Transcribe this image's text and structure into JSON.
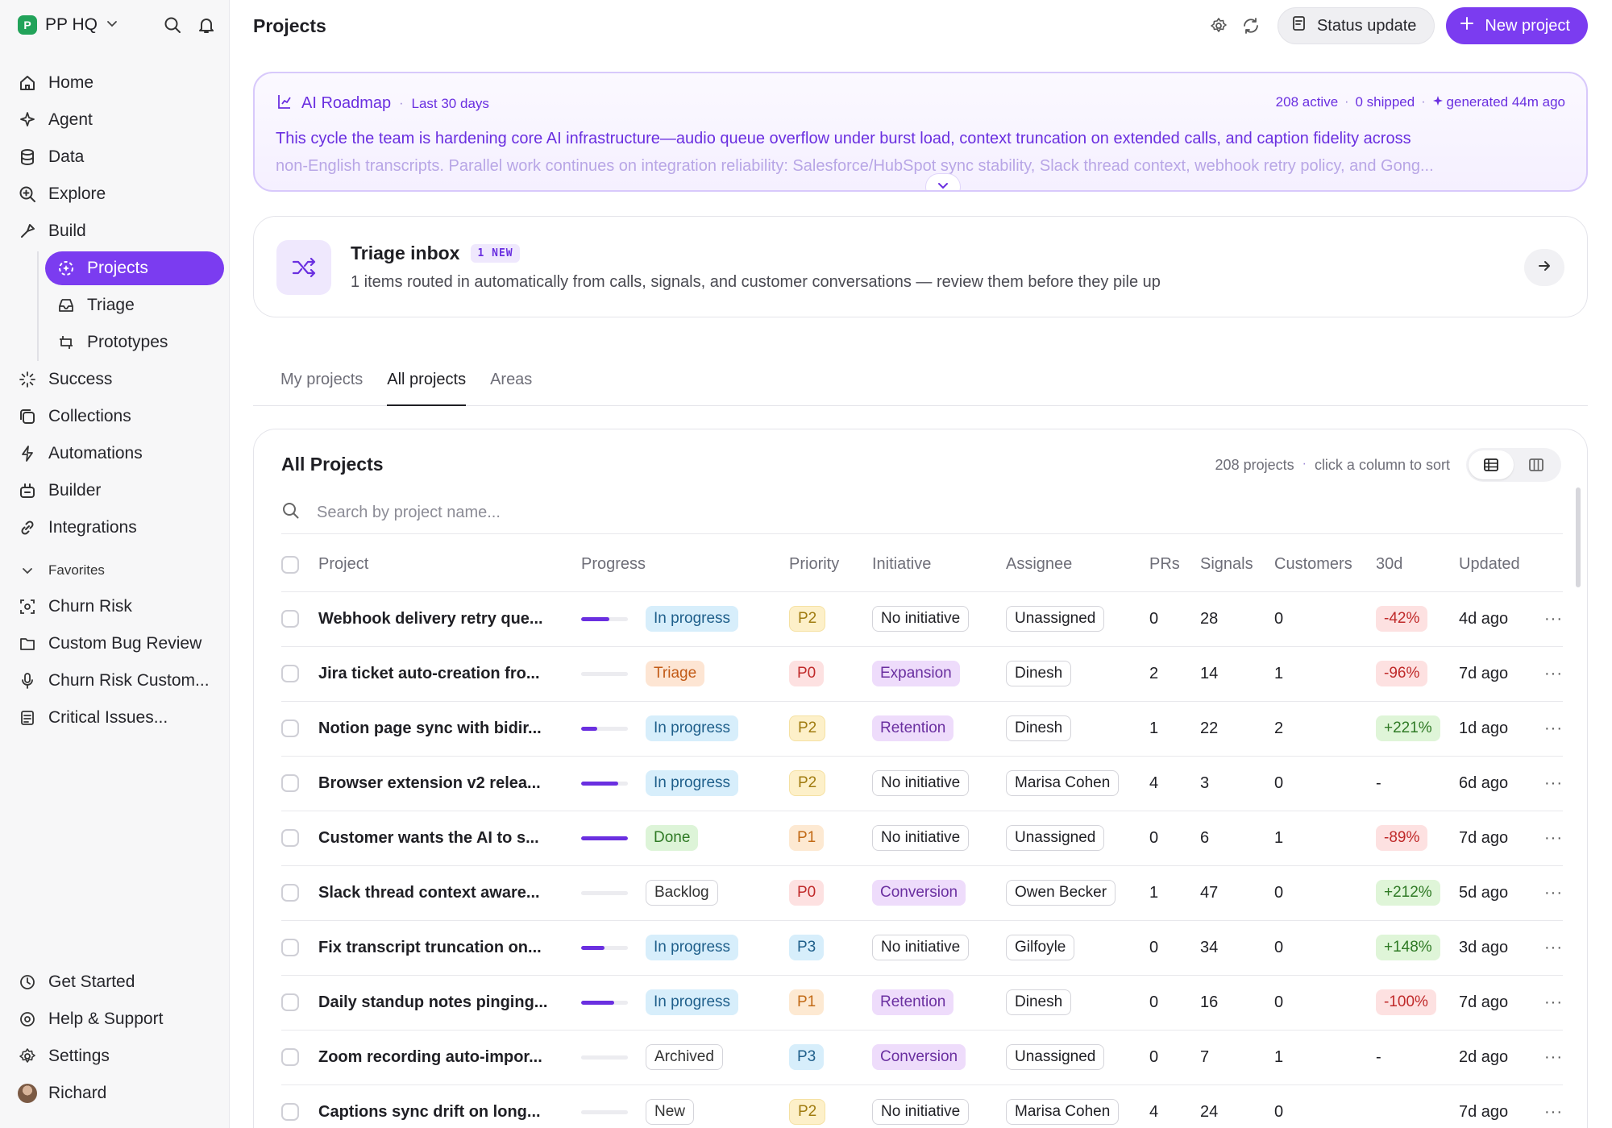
{
  "workspace": {
    "name": "PP HQ",
    "logo_letter": "P"
  },
  "sidebar": {
    "nav": [
      {
        "label": "Home",
        "icon": "home-icon"
      },
      {
        "label": "Agent",
        "icon": "agent-icon"
      },
      {
        "label": "Data",
        "icon": "database-icon"
      },
      {
        "label": "Explore",
        "icon": "explore-icon"
      },
      {
        "label": "Build",
        "icon": "build-icon"
      }
    ],
    "build_sub": [
      {
        "label": "Projects",
        "icon": "projects-icon",
        "active": true
      },
      {
        "label": "Triage",
        "icon": "triage-icon"
      },
      {
        "label": "Prototypes",
        "icon": "prototypes-icon"
      }
    ],
    "nav2": [
      {
        "label": "Success",
        "icon": "success-icon"
      },
      {
        "label": "Collections",
        "icon": "collections-icon"
      },
      {
        "label": "Automations",
        "icon": "automations-icon"
      },
      {
        "label": "Builder",
        "icon": "builder-icon"
      },
      {
        "label": "Integrations",
        "icon": "integrations-icon"
      }
    ],
    "favorites_label": "Favorites",
    "favorites": [
      {
        "label": "Churn Risk",
        "icon": "churn-icon"
      },
      {
        "label": "Custom Bug Review",
        "icon": "folder-icon"
      },
      {
        "label": "Churn Risk Custom...",
        "icon": "microphone-icon"
      },
      {
        "label": "Critical Issues...",
        "icon": "document-icon"
      }
    ],
    "bottom": [
      {
        "label": "Get Started",
        "icon": "clock-icon"
      },
      {
        "label": "Help & Support",
        "icon": "help-icon"
      },
      {
        "label": "Settings",
        "icon": "settings-icon"
      },
      {
        "label": "Richard",
        "icon": "avatar"
      }
    ]
  },
  "header": {
    "title": "Projects",
    "status_update": "Status update",
    "new_project": "New project"
  },
  "roadmap": {
    "title": "AI Roadmap",
    "period": "Last 30 days",
    "active": "208 active",
    "shipped": "0 shipped",
    "generated": "generated 44m ago",
    "line1": "This cycle the team is hardening core AI infrastructure—audio queue overflow under burst load, context truncation on extended calls, and caption fidelity across",
    "line2": "non-English transcripts. Parallel work continues on integration reliability: Salesforce/HubSpot sync stability, Slack thread context, webhook retry policy, and Gong..."
  },
  "triage": {
    "title": "Triage inbox",
    "badge": "1 NEW",
    "subtitle": "1 items routed in automatically from calls, signals, and customer conversations — review them before they pile up"
  },
  "tabs": [
    {
      "label": "My projects",
      "active": false
    },
    {
      "label": "All projects",
      "active": true
    },
    {
      "label": "Areas",
      "active": false
    }
  ],
  "panel": {
    "title": "All Projects",
    "count": "208 projects",
    "hint": "click a column to sort",
    "search_placeholder": "Search by project name..."
  },
  "columns": [
    "Project",
    "Progress",
    "Priority",
    "Initiative",
    "Assignee",
    "PRs",
    "Signals",
    "Customers",
    "30d",
    "Updated"
  ],
  "rows": [
    {
      "name": "Webhook delivery retry que...",
      "progress": 0.6,
      "status": "In progress",
      "status_kind": "progress",
      "priority": "P2",
      "initiative": "No initiative",
      "assignee": "Unassigned",
      "prs": "0",
      "signals": "28",
      "customers": "0",
      "delta": "-42%",
      "delta_kind": "neg",
      "updated": "4d ago"
    },
    {
      "name": "Jira ticket auto-creation fro...",
      "progress": 0,
      "status": "Triage",
      "status_kind": "triage",
      "priority": "P0",
      "initiative": "Expansion",
      "assignee": "Dinesh",
      "prs": "2",
      "signals": "14",
      "customers": "1",
      "delta": "-96%",
      "delta_kind": "neg",
      "updated": "7d ago"
    },
    {
      "name": "Notion page sync with bidir...",
      "progress": 0.35,
      "status": "In progress",
      "status_kind": "progress",
      "priority": "P2",
      "initiative": "Retention",
      "assignee": "Dinesh",
      "prs": "1",
      "signals": "22",
      "customers": "2",
      "delta": "+221%",
      "delta_kind": "pos",
      "updated": "1d ago"
    },
    {
      "name": "Browser extension v2 relea...",
      "progress": 0.8,
      "status": "In progress",
      "status_kind": "progress",
      "priority": "P2",
      "initiative": "No initiative",
      "assignee": "Marisa Cohen",
      "prs": "4",
      "signals": "3",
      "customers": "0",
      "delta": "-",
      "delta_kind": "none",
      "updated": "6d ago"
    },
    {
      "name": "Customer wants the AI to s...",
      "progress": 1,
      "status": "Done",
      "status_kind": "done",
      "priority": "P1",
      "initiative": "No initiative",
      "assignee": "Unassigned",
      "prs": "0",
      "signals": "6",
      "customers": "1",
      "delta": "-89%",
      "delta_kind": "neg",
      "updated": "7d ago"
    },
    {
      "name": "Slack thread context aware...",
      "progress": 0,
      "status": "Backlog",
      "status_kind": "backlog",
      "priority": "P0",
      "initiative": "Conversion",
      "assignee": "Owen Becker",
      "prs": "1",
      "signals": "47",
      "customers": "0",
      "delta": "+212%",
      "delta_kind": "pos",
      "updated": "5d ago"
    },
    {
      "name": "Fix transcript truncation on...",
      "progress": 0.5,
      "status": "In progress",
      "status_kind": "progress",
      "priority": "P3",
      "initiative": "No initiative",
      "assignee": "Gilfoyle",
      "prs": "0",
      "signals": "34",
      "customers": "0",
      "delta": "+148%",
      "delta_kind": "pos",
      "updated": "3d ago"
    },
    {
      "name": "Daily standup notes pinging...",
      "progress": 0.7,
      "status": "In progress",
      "status_kind": "progress",
      "priority": "P1",
      "initiative": "Retention",
      "assignee": "Dinesh",
      "prs": "0",
      "signals": "16",
      "customers": "0",
      "delta": "-100%",
      "delta_kind": "neg",
      "updated": "7d ago"
    },
    {
      "name": "Zoom recording auto-impor...",
      "progress": 0,
      "status": "Archived",
      "status_kind": "archived",
      "priority": "P3",
      "initiative": "Conversion",
      "assignee": "Unassigned",
      "prs": "0",
      "signals": "7",
      "customers": "1",
      "delta": "-",
      "delta_kind": "none",
      "updated": "2d ago"
    },
    {
      "name": "Captions sync drift on long...",
      "progress": 0,
      "status": "New",
      "status_kind": "new",
      "priority": "P2",
      "initiative": "No initiative",
      "assignee": "Marisa Cohen",
      "prs": "4",
      "signals": "24",
      "customers": "0",
      "delta": "",
      "delta_kind": "none",
      "updated": "7d ago"
    }
  ],
  "colors": {
    "accent": "#7b3cf0",
    "roadmap_text": "#6a2fe0",
    "logo": "#22a35a"
  }
}
